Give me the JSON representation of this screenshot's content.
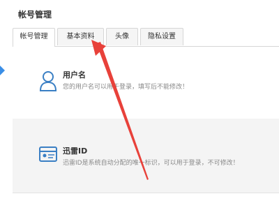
{
  "page": {
    "title": "帐号管理"
  },
  "tabs": [
    {
      "label": "帐号管理",
      "active": true
    },
    {
      "label": "基本资料",
      "active": false
    },
    {
      "label": "头像",
      "active": false
    },
    {
      "label": "隐私设置",
      "active": false
    }
  ],
  "sections": {
    "username": {
      "title": "用户名",
      "desc": "您的用户名可以用于登录，填写后不能修改！",
      "icon": "user-icon"
    },
    "xunlei_id": {
      "title": "迅雷ID",
      "desc": "迅雷ID是系统自动分配的唯一标识，可以用于登录，不可修改！",
      "icon": "id-card-icon"
    }
  },
  "colors": {
    "accent": "#3a8ee6",
    "annotation_arrow": "#e8413a",
    "icon": "#3a7fc4"
  }
}
